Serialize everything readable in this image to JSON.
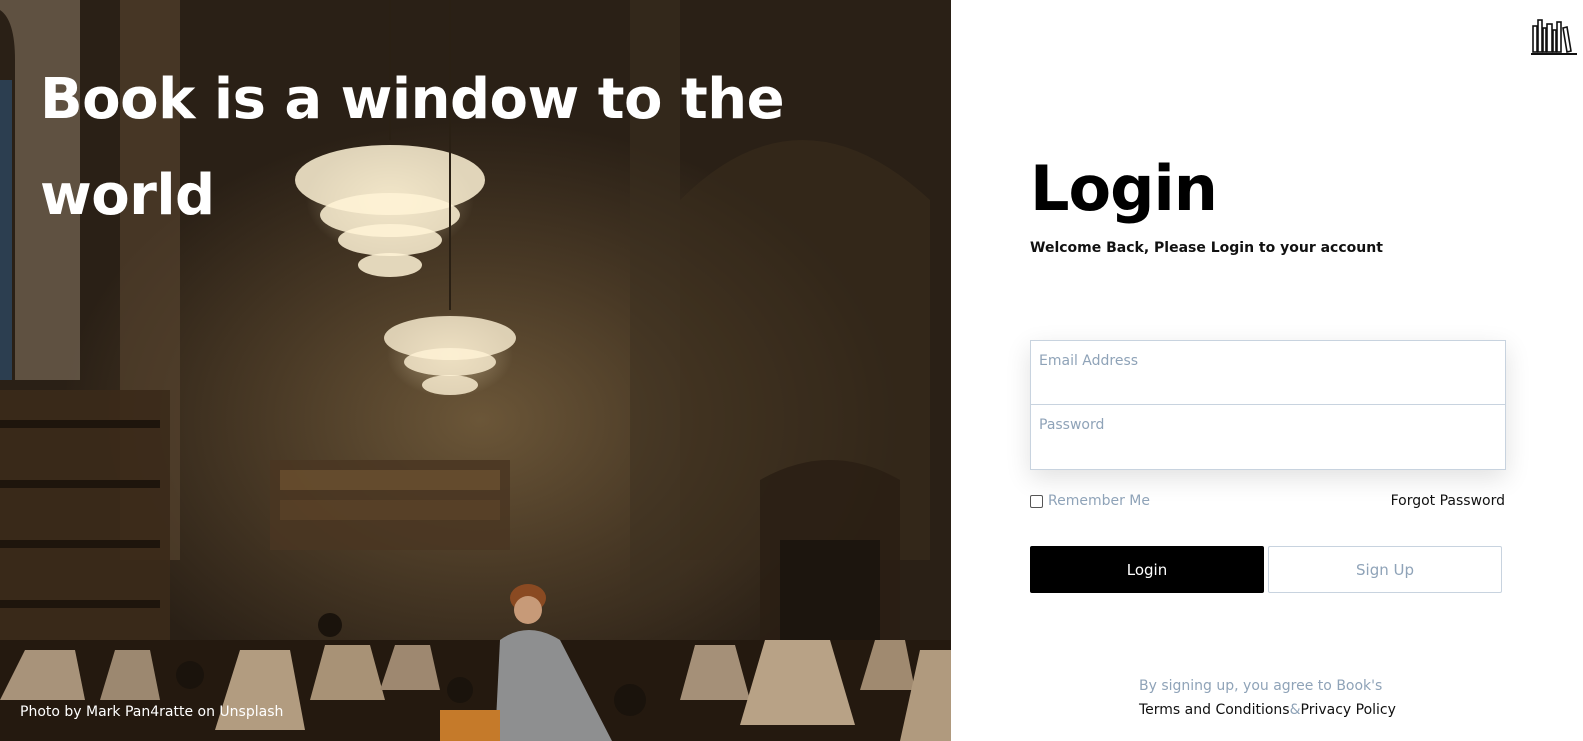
{
  "hero": {
    "headline": "Book is a window to the world",
    "photo_credit": "Photo by Mark Pan4ratte on Unsplash"
  },
  "brand": {
    "logo_icon": "bookshelf-icon"
  },
  "login": {
    "title": "Login",
    "subtitle": "Welcome Back, Please Login to your account",
    "email_placeholder": "Email Address",
    "password_placeholder": "Password",
    "remember_label": "Remember Me",
    "remember_checked": false,
    "forgot_label": "Forgot Password",
    "login_button": "Login",
    "signup_button": "Sign Up"
  },
  "terms": {
    "line1": "By signing up, you agree to Book's",
    "terms_link": "Terms and Conditions",
    "separator": "&",
    "privacy_link": "Privacy Policy"
  },
  "colors": {
    "primary_button": "#000000",
    "muted_text": "#8fa3b8",
    "border": "#c8d3df"
  }
}
